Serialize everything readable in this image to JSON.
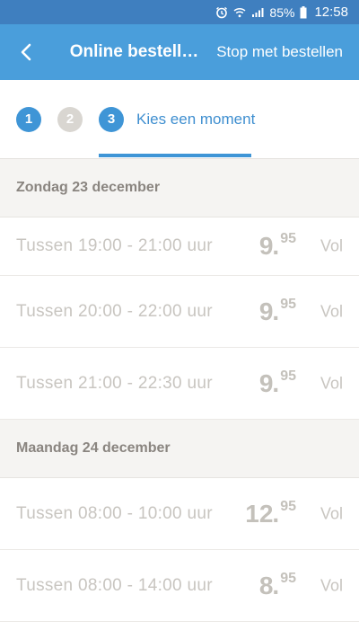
{
  "status_bar": {
    "battery": "85%",
    "time": "12:58",
    "icons": [
      "alarm-icon",
      "wifi-icon",
      "signal-icon",
      "battery-icon"
    ]
  },
  "app_bar": {
    "title": "Online bestell…",
    "stop_label": "Stop met bestellen",
    "back_icon": "chevron-left-icon",
    "color": "#4a9edb"
  },
  "steps": {
    "step1": "1",
    "step2": "2",
    "step3": "3",
    "active_label": "Kies een moment",
    "accent": "#3f95d6"
  },
  "days": [
    {
      "label": "Zondag 23 december",
      "slots": [
        {
          "prefix": "Tussen",
          "range": "19:00 - 21:00",
          "unit": "uur",
          "price_int": "9",
          "price_cents": "95",
          "status": "Vol"
        },
        {
          "prefix": "Tussen",
          "range": "20:00 - 22:00",
          "unit": "uur",
          "price_int": "9",
          "price_cents": "95",
          "status": "Vol"
        },
        {
          "prefix": "Tussen",
          "range": "21:00 - 22:30",
          "unit": "uur",
          "price_int": "9",
          "price_cents": "95",
          "status": "Vol"
        }
      ]
    },
    {
      "label": "Maandag 24 december",
      "slots": [
        {
          "prefix": "Tussen",
          "range": "08:00 - 10:00",
          "unit": "uur",
          "price_int": "12",
          "price_cents": "95",
          "status": "Vol"
        },
        {
          "prefix": "Tussen",
          "range": "08:00 - 14:00",
          "unit": "uur",
          "price_int": "8",
          "price_cents": "95",
          "status": "Vol"
        }
      ]
    }
  ]
}
